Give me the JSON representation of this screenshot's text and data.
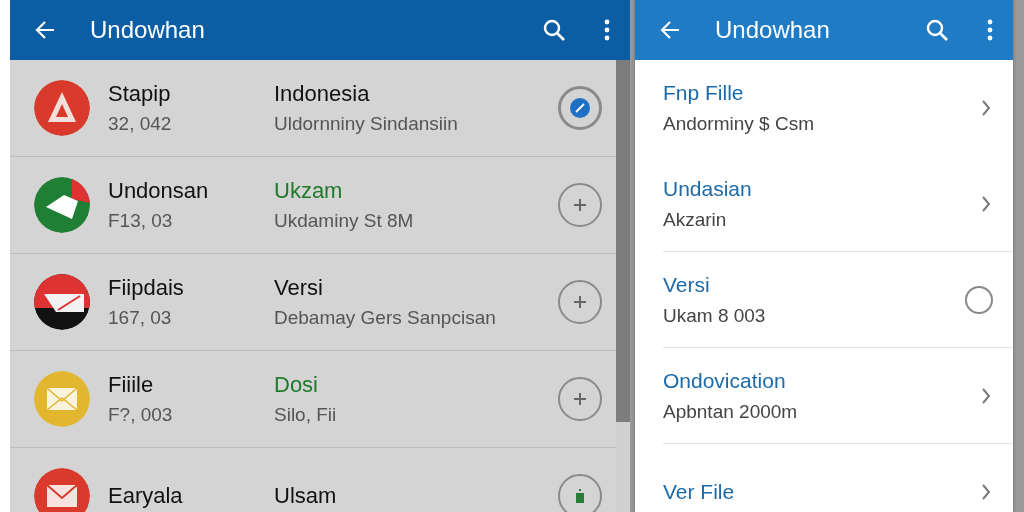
{
  "left_panel": {
    "title": "Undowhan",
    "rows": [
      {
        "name": "Stapip",
        "number": "32, 042",
        "label": "Indonesia",
        "highlight": false,
        "detail": "Uldornniny Sindansiin",
        "kind": "check",
        "checked": true
      },
      {
        "name": "Undonsan",
        "number": "F13, 03",
        "label": "Ukzam",
        "highlight": true,
        "detail": "Ukdaminy St 8M",
        "kind": "add"
      },
      {
        "name": "Fiipdais",
        "number": "167, 03",
        "label": "Versi",
        "highlight": false,
        "detail": "Debamay Gers Sanpcisan",
        "kind": "add"
      },
      {
        "name": "Fiiile",
        "number": "F?, 003",
        "label": "Dosi",
        "highlight": true,
        "detail": "Silo, Fii",
        "kind": "add"
      },
      {
        "name": "Earyala",
        "label": "Ulsam",
        "highlight": false,
        "kind": "battery"
      }
    ]
  },
  "right_panel": {
    "title": "Undowhan",
    "rows": [
      {
        "title": "Fnp Fille",
        "subtitle": "Andorminy $ Csm",
        "kind": "chevron"
      },
      {
        "title": "Undasian",
        "subtitle": "Akzarin",
        "kind": "chevron"
      },
      {
        "title": "Versi",
        "subtitle": "Ukam 8 003",
        "kind": "radio",
        "checked": false
      },
      {
        "title": "Ondovication",
        "subtitle": "Apbntan 2000m",
        "kind": "chevron"
      },
      {
        "title": "Ver File",
        "kind": "chevron"
      }
    ]
  }
}
